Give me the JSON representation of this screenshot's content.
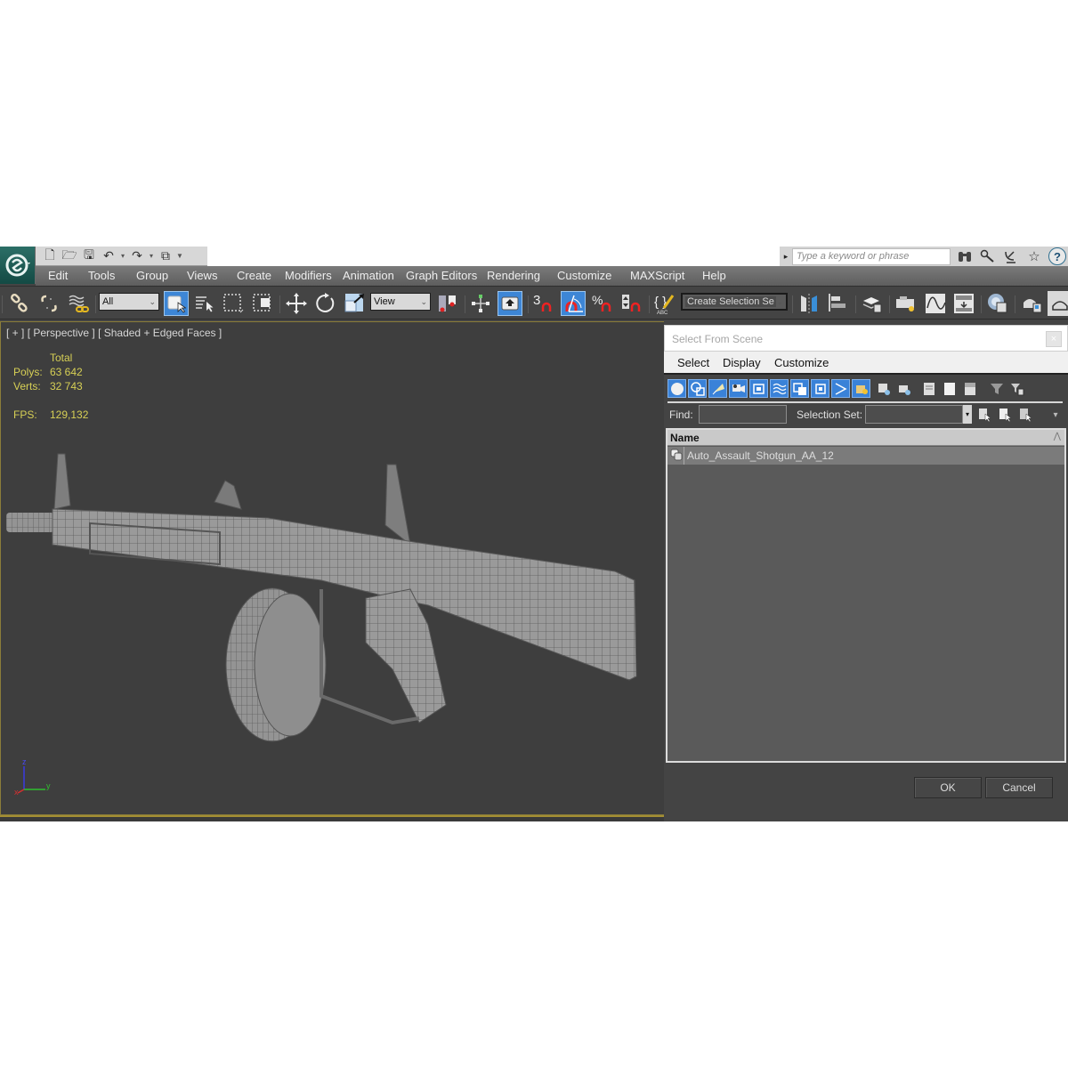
{
  "app": {
    "logo_icon": "3dsmax-logo-icon"
  },
  "quick_access": {
    "buttons": [
      {
        "name": "new-file-icon",
        "glyph": "🗋"
      },
      {
        "name": "open-file-icon",
        "glyph": "🗁"
      },
      {
        "name": "save-file-icon",
        "glyph": "🖫"
      },
      {
        "name": "undo-icon",
        "glyph": "↶"
      },
      {
        "name": "redo-icon",
        "glyph": "↷"
      },
      {
        "name": "project-folder-icon",
        "glyph": "⧉"
      }
    ],
    "dropdown_glyph": "▾",
    "customize_glyph": "▼"
  },
  "search": {
    "arrow": "▸",
    "placeholder": "Type a keyword or phrase",
    "icons": [
      {
        "name": "binoculars-icon",
        "glyph": "🔭"
      },
      {
        "name": "key-icon",
        "glyph": "⚷"
      },
      {
        "name": "satellite-icon",
        "glyph": "📡"
      },
      {
        "name": "star-icon",
        "glyph": "☆"
      }
    ],
    "help_label": "?"
  },
  "menu": {
    "items": [
      "Edit",
      "Tools",
      "Group",
      "Views",
      "Create",
      "Modifiers",
      "Animation",
      "Graph Editors",
      "Rendering",
      "Customize",
      "MAXScript",
      "Help"
    ]
  },
  "toolbar": {
    "selection_filter": "All",
    "ref_coord": "View",
    "named_selection": "Create Selection Se",
    "chevron": "⌄",
    "snap_label": "3"
  },
  "viewport": {
    "label_plus": "[ + ]",
    "label_view": "[ Perspective ]",
    "label_shading": "[ Shaded + Edged Faces ]",
    "stats": {
      "header": "Total",
      "polys_label": "Polys:",
      "polys_value": "63 642",
      "verts_label": "Verts:",
      "verts_value": "32 743",
      "fps_label": "FPS:",
      "fps_value": "129,132"
    },
    "axis": {
      "x": "x",
      "y": "y",
      "z": "z"
    },
    "model_name": "Auto_Assault_Shotgun_AA_12"
  },
  "dialog": {
    "title": "Select From Scene",
    "close_glyph": "×",
    "menu": [
      "Select",
      "Display",
      "Customize"
    ],
    "find_label": "Find:",
    "find_value": "",
    "selection_set_label": "Selection Set:",
    "selection_set_value": "",
    "dropdown_glyph": "▾",
    "column_header": "Name",
    "sort_glyph": "⋀",
    "rows": [
      {
        "name": "Auto_Assault_Shotgun_AA_12",
        "icon": "object-icon"
      }
    ],
    "ok_label": "OK",
    "cancel_label": "Cancel"
  }
}
